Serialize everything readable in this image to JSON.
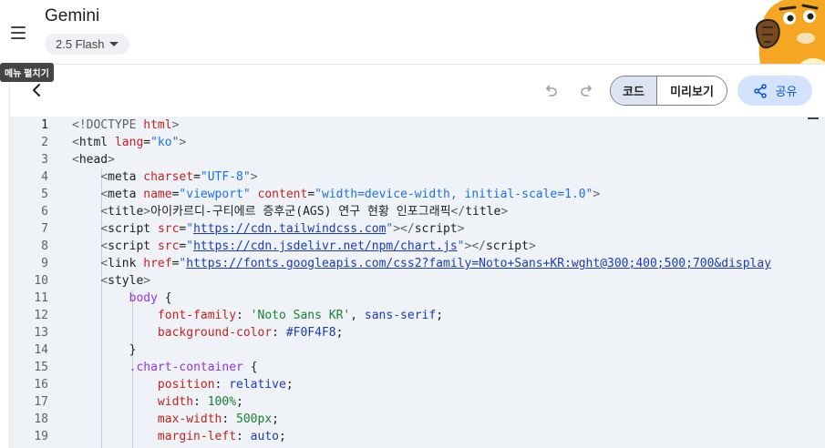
{
  "app": {
    "title": "Gemini",
    "model_label": "2.5 Flash"
  },
  "tooltip": {
    "text": "메뉴 펼치기"
  },
  "toolbar": {
    "code_label": "코드",
    "preview_label": "미리보기",
    "share_label": "공유"
  },
  "colors": {
    "accent": "#0b57d0",
    "share_bg": "#d3e3fd",
    "segment_active": "#dce4f3",
    "editor_bg": "#eff2f6"
  },
  "icons": {
    "menu": "hamburger-icon",
    "back": "chevron-left-icon",
    "undo": "undo-icon",
    "redo": "redo-icon",
    "share": "share-icon"
  },
  "editor": {
    "active_line": 1,
    "lines": [
      {
        "n": "1",
        "tokens": [
          [
            "t-doc",
            "<!DOCTYPE "
          ],
          [
            "t-attr",
            "html"
          ],
          [
            "t-doc",
            ">"
          ]
        ]
      },
      {
        "n": "2",
        "tokens": [
          [
            "t-brk",
            "<"
          ],
          [
            "t-tag",
            "html "
          ],
          [
            "t-attr",
            "lang"
          ],
          [
            "t-pun",
            "="
          ],
          [
            "t-str",
            "\"ko\""
          ],
          [
            "t-brk",
            ">"
          ]
        ]
      },
      {
        "n": "3",
        "tokens": [
          [
            "t-brk",
            "<"
          ],
          [
            "t-tag",
            "head"
          ],
          [
            "t-brk",
            ">"
          ]
        ]
      },
      {
        "n": "4",
        "tokens": [
          [
            "t-pun",
            "    "
          ],
          [
            "t-brk",
            "<"
          ],
          [
            "t-tag",
            "meta "
          ],
          [
            "t-attr",
            "charset"
          ],
          [
            "t-pun",
            "="
          ],
          [
            "t-str",
            "\"UTF-8\""
          ],
          [
            "t-brk",
            ">"
          ]
        ]
      },
      {
        "n": "5",
        "tokens": [
          [
            "t-pun",
            "    "
          ],
          [
            "t-brk",
            "<"
          ],
          [
            "t-tag",
            "meta "
          ],
          [
            "t-attr",
            "name"
          ],
          [
            "t-pun",
            "="
          ],
          [
            "t-str",
            "\"viewport\" "
          ],
          [
            "t-attr",
            "content"
          ],
          [
            "t-pun",
            "="
          ],
          [
            "t-str",
            "\"width=device-width, initial-scale=1.0\""
          ],
          [
            "t-brk",
            ">"
          ]
        ]
      },
      {
        "n": "6",
        "tokens": [
          [
            "t-pun",
            "    "
          ],
          [
            "t-brk",
            "<"
          ],
          [
            "t-tag",
            "title"
          ],
          [
            "t-brk",
            ">"
          ],
          [
            "t-txt",
            "아이카르디-구티에르 증후군(AGS) 연구 현황 인포그래픽"
          ],
          [
            "t-brk",
            "</"
          ],
          [
            "t-tag",
            "title"
          ],
          [
            "t-brk",
            ">"
          ]
        ]
      },
      {
        "n": "7",
        "tokens": [
          [
            "t-pun",
            "    "
          ],
          [
            "t-brk",
            "<"
          ],
          [
            "t-tag",
            "script "
          ],
          [
            "t-attr",
            "src"
          ],
          [
            "t-pun",
            "="
          ],
          [
            "t-str",
            "\""
          ],
          [
            "t-url",
            "https://cdn.tailwindcss.com"
          ],
          [
            "t-str",
            "\""
          ],
          [
            "t-brk",
            "></"
          ],
          [
            "t-tag",
            "script"
          ],
          [
            "t-brk",
            ">"
          ]
        ]
      },
      {
        "n": "8",
        "tokens": [
          [
            "t-pun",
            "    "
          ],
          [
            "t-brk",
            "<"
          ],
          [
            "t-tag",
            "script "
          ],
          [
            "t-attr",
            "src"
          ],
          [
            "t-pun",
            "="
          ],
          [
            "t-str",
            "\""
          ],
          [
            "t-url",
            "https://cdn.jsdelivr.net/npm/chart.js"
          ],
          [
            "t-str",
            "\""
          ],
          [
            "t-brk",
            "></"
          ],
          [
            "t-tag",
            "script"
          ],
          [
            "t-brk",
            ">"
          ]
        ]
      },
      {
        "n": "9",
        "tokens": [
          [
            "t-pun",
            "    "
          ],
          [
            "t-brk",
            "<"
          ],
          [
            "t-tag",
            "link "
          ],
          [
            "t-attr",
            "href"
          ],
          [
            "t-pun",
            "="
          ],
          [
            "t-str",
            "\""
          ],
          [
            "t-url",
            "https://fonts.googleapis.com/css2?family=Noto+Sans+KR:wght@300;400;500;700&display"
          ]
        ]
      },
      {
        "n": "10",
        "tokens": [
          [
            "t-pun",
            "    "
          ],
          [
            "t-brk",
            "<"
          ],
          [
            "t-tag",
            "style"
          ],
          [
            "t-brk",
            ">"
          ]
        ]
      },
      {
        "n": "11",
        "tokens": [
          [
            "t-pun",
            "        "
          ],
          [
            "t-sel",
            "body "
          ],
          [
            "t-pun",
            "{"
          ]
        ]
      },
      {
        "n": "12",
        "tokens": [
          [
            "t-pun",
            "            "
          ],
          [
            "t-prop",
            "font-family"
          ],
          [
            "t-pun",
            ": "
          ],
          [
            "t-sstr",
            "'Noto Sans KR'"
          ],
          [
            "t-pun",
            ", "
          ],
          [
            "t-val",
            "sans-serif"
          ],
          [
            "t-pun",
            ";"
          ]
        ]
      },
      {
        "n": "13",
        "tokens": [
          [
            "t-pun",
            "            "
          ],
          [
            "t-prop",
            "background-color"
          ],
          [
            "t-pun",
            ": "
          ],
          [
            "t-val",
            "#F0F4F8"
          ],
          [
            "t-pun",
            ";"
          ]
        ]
      },
      {
        "n": "14",
        "tokens": [
          [
            "t-pun",
            "        "
          ],
          [
            "t-pun",
            "}"
          ]
        ]
      },
      {
        "n": "15",
        "tokens": [
          [
            "t-pun",
            "        "
          ],
          [
            "t-sel",
            ".chart-container "
          ],
          [
            "t-pun",
            "{"
          ]
        ]
      },
      {
        "n": "16",
        "tokens": [
          [
            "t-pun",
            "            "
          ],
          [
            "t-prop",
            "position"
          ],
          [
            "t-pun",
            ": "
          ],
          [
            "t-val",
            "relative"
          ],
          [
            "t-pun",
            ";"
          ]
        ]
      },
      {
        "n": "17",
        "tokens": [
          [
            "t-pun",
            "            "
          ],
          [
            "t-prop",
            "width"
          ],
          [
            "t-pun",
            ": "
          ],
          [
            "t-num",
            "100%"
          ],
          [
            "t-pun",
            ";"
          ]
        ]
      },
      {
        "n": "18",
        "tokens": [
          [
            "t-pun",
            "            "
          ],
          [
            "t-prop",
            "max-width"
          ],
          [
            "t-pun",
            ": "
          ],
          [
            "t-num",
            "500px"
          ],
          [
            "t-pun",
            ";"
          ]
        ]
      },
      {
        "n": "19",
        "tokens": [
          [
            "t-pun",
            "            "
          ],
          [
            "t-prop",
            "margin-left"
          ],
          [
            "t-pun",
            ": "
          ],
          [
            "t-val",
            "auto"
          ],
          [
            "t-pun",
            ";"
          ]
        ]
      }
    ]
  }
}
